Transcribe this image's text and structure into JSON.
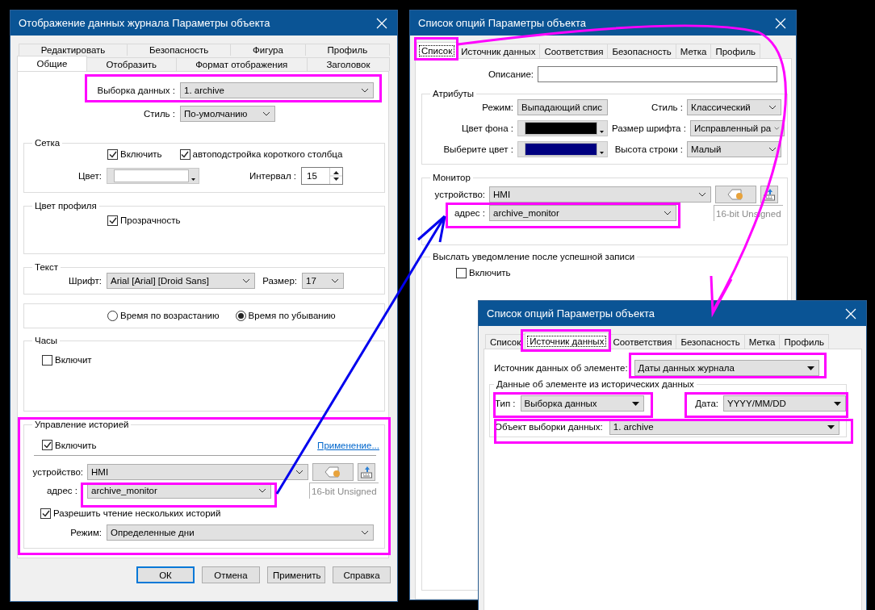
{
  "log_dialog": {
    "title": "Отображение данных журнала Параметры объекта",
    "tab_rows": [
      [
        {
          "label": "Редактировать",
          "selected": false
        },
        {
          "label": "Безопасность",
          "selected": false
        },
        {
          "label": "Фигура",
          "selected": false
        },
        {
          "label": "Профиль",
          "selected": false
        }
      ],
      [
        {
          "label": "Общие",
          "selected": true
        },
        {
          "label": "Отобразить",
          "selected": false
        },
        {
          "label": "Формат отображения",
          "selected": false
        },
        {
          "label": "Заголовок",
          "selected": false
        }
      ]
    ],
    "data_selection": {
      "label": "Выборка данных :",
      "value": "1. archive"
    },
    "style": {
      "label": "Стиль :",
      "value": "По-умолчанию"
    },
    "grid": {
      "title": "Сетка",
      "enable": {
        "label": "Включить",
        "checked": true
      },
      "autofit": {
        "label": "автоподстройка короткого столбца",
        "checked": true
      },
      "color_label": "Цвет:",
      "color": "#ffffff",
      "interval_label": "Интервал :",
      "interval": "15"
    },
    "profile_color": {
      "title": "Цвет профиля",
      "transparency": {
        "label": "Прозрачность",
        "checked": true
      }
    },
    "text": {
      "title": "Текст",
      "font_label": "Шрифт:",
      "font": "Arial [Arial] [Droid Sans]",
      "size_label": "Размер:",
      "size": "17"
    },
    "time_order": [
      {
        "label": "Время по возрастанию",
        "selected": false
      },
      {
        "label": "Время по убыванию",
        "selected": true
      }
    ],
    "clock": {
      "title": "Часы",
      "enable": {
        "label": "Включит",
        "checked": false
      }
    },
    "history": {
      "title": "Управление историей",
      "enable": {
        "label": "Включить",
        "checked": true
      },
      "link": "Применение...",
      "device_label": "устройство:",
      "device": "HMI",
      "address_label": "адрес :",
      "address": "archive_monitor",
      "data_type": "16-bit Unsigned",
      "multi": {
        "label": "Разрешить чтение нескольких историй",
        "checked": true
      },
      "mode_label": "Режим:",
      "mode": "Определенные дни"
    },
    "buttons": [
      {
        "label": "ОК",
        "default": true
      },
      {
        "label": "Отмена",
        "default": false
      },
      {
        "label": "Применить",
        "default": false
      },
      {
        "label": "Справка",
        "default": false
      }
    ]
  },
  "list_dialog": {
    "title": "Список опций Параметры объекта",
    "tabs": [
      {
        "label": "Список",
        "selected": true
      },
      {
        "label": "Источник данных",
        "selected": false
      },
      {
        "label": "Соответствия",
        "selected": false
      },
      {
        "label": "Безопасность",
        "selected": false
      },
      {
        "label": "Метка",
        "selected": false
      },
      {
        "label": "Профиль",
        "selected": false
      }
    ],
    "description_label": "Описание:",
    "attributes": {
      "title": "Атрибуты",
      "left": [
        {
          "kind": "dropdown",
          "label": "Режим:",
          "value": "Выпадающий спис"
        },
        {
          "kind": "color",
          "label": "Цвет фона :",
          "color": "#000000"
        },
        {
          "kind": "color",
          "label": "Выберите цвет :",
          "color": "#000080"
        }
      ],
      "right": [
        {
          "label": "Стиль :",
          "value": "Классический"
        },
        {
          "label": "Размер шрифта :",
          "value": "Исправленный ра"
        },
        {
          "label": "Высота строки :",
          "value": "Малый"
        }
      ]
    },
    "monitor": {
      "title": "Монитор",
      "device_label": "устройство:",
      "device": "HMI",
      "address_label": "адрес :",
      "address": "archive_monitor",
      "data_type": "16-bit Unsigned"
    },
    "notify": {
      "title": "Выслать уведомление после успешной записи",
      "enable": {
        "label": "Включить",
        "checked": false
      }
    }
  },
  "source_dialog": {
    "title": "Список опций Параметры объекта",
    "tabs": [
      {
        "label": "Список",
        "selected": false
      },
      {
        "label": "Источник данных",
        "selected": true
      },
      {
        "label": "Соответствия",
        "selected": false
      },
      {
        "label": "Безопасность",
        "selected": false
      },
      {
        "label": "Метка",
        "selected": false
      },
      {
        "label": "Профиль",
        "selected": false
      }
    ],
    "source_label": "Источник данных об элементе:",
    "source": "Даты данных журнала",
    "history": {
      "title": "Данные об элементе из исторических данных",
      "type_label": "Тип :",
      "type": "Выборка данных",
      "date_label": "Дата:",
      "date": "YYYY/MM/DD",
      "object_label": "Объект выборки данных:",
      "object": "1. archive"
    }
  }
}
